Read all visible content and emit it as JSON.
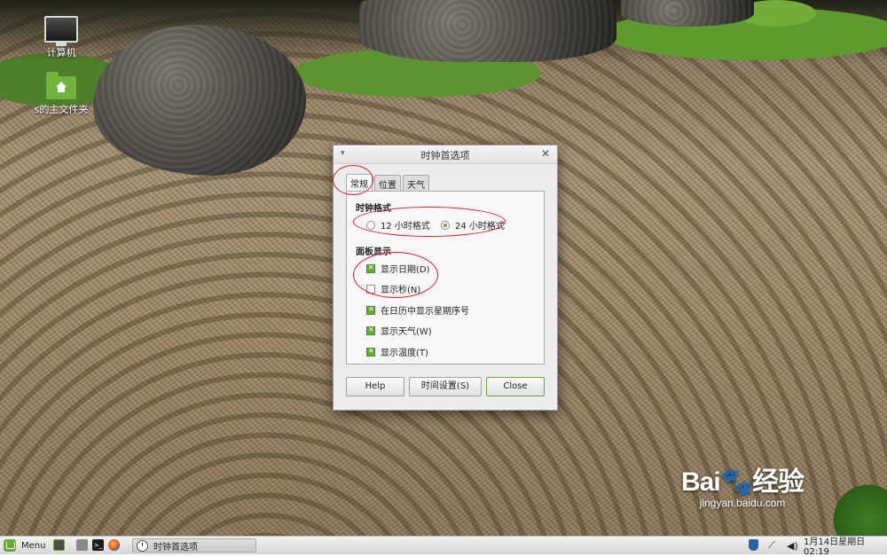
{
  "desktop": {
    "icons": [
      {
        "label": "计算机",
        "icon": "computer-icon"
      },
      {
        "label": "s的主文件夹",
        "icon": "home-folder-icon"
      }
    ]
  },
  "dialog": {
    "title": "时钟首选项",
    "menu_glyph": "▾",
    "close_glyph": "✕",
    "tabs": [
      {
        "label": "常规",
        "active": true
      },
      {
        "label": "位置",
        "active": false
      },
      {
        "label": "天气",
        "active": false
      }
    ],
    "clock_format": {
      "title": "时钟格式",
      "options": [
        {
          "label": "12 小时格式",
          "selected": false
        },
        {
          "label": "24 小时格式",
          "selected": true
        }
      ]
    },
    "panel_display": {
      "title": "面板显示",
      "items": [
        {
          "label": "显示日期(D)",
          "checked": true
        },
        {
          "label": "显示秒(N)",
          "checked": false
        },
        {
          "label": "在日历中显示星期序号",
          "checked": true
        },
        {
          "label": "显示天气(W)",
          "checked": true
        },
        {
          "label": "显示温度(T)",
          "checked": true
        }
      ]
    },
    "buttons": {
      "help": "Help",
      "time_settings": "时间设置(S)",
      "close": "Close"
    }
  },
  "taskbar": {
    "menu_label": "Menu",
    "terminal_glyph": ">_",
    "window_item": "时钟首选项",
    "net_glyph": "⟋",
    "volume_glyph": "◀)",
    "clock": "1月14日星期日 02:19"
  },
  "watermark": {
    "brand": "Bai🐾经验",
    "url": "jingyan.baidu.com"
  },
  "colors": {
    "accent": "#6aa83a",
    "annotation": "#e01e2a"
  }
}
